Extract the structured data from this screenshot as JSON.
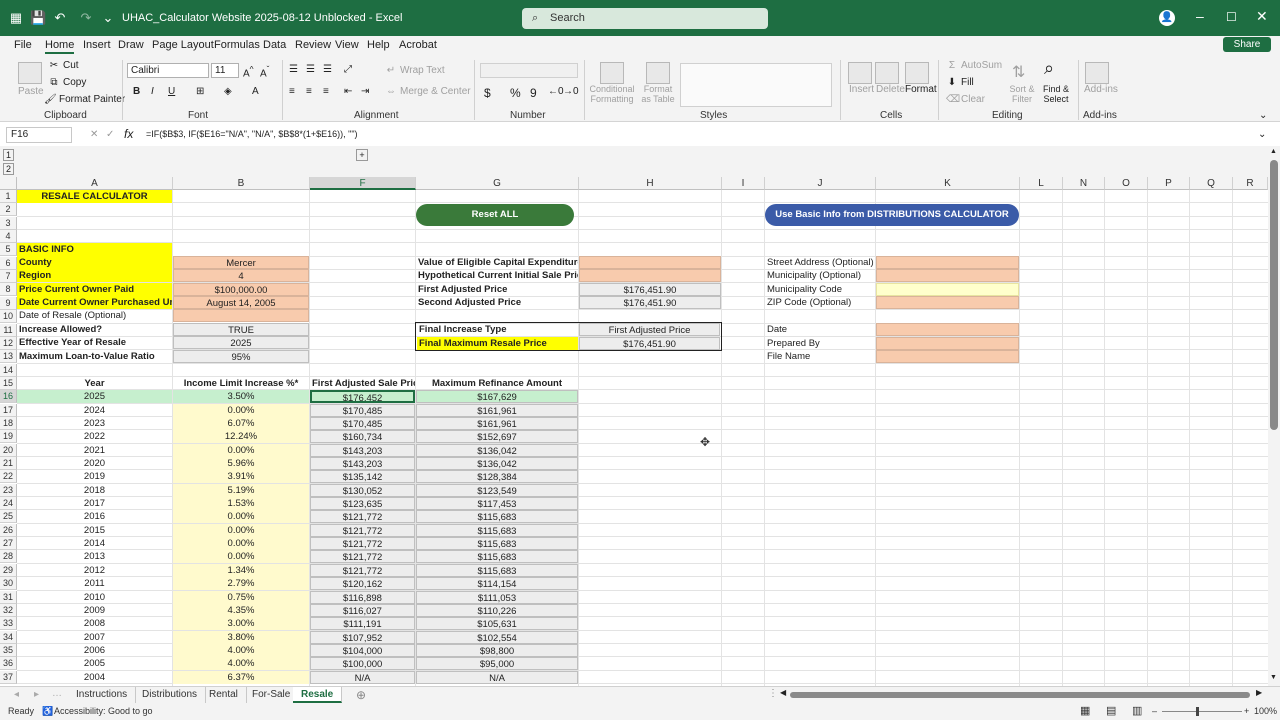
{
  "app": {
    "title": "UHAC_Calculator Website 2025-08-12 Unblocked  -  Excel",
    "search_placeholder": "Search",
    "avatar": "👤",
    "share_label": "Share"
  },
  "menu": [
    "File",
    "Home",
    "Insert",
    "Draw",
    "Page Layout",
    "Formulas",
    "Data",
    "Review",
    "View",
    "Help",
    "Acrobat"
  ],
  "ribbon": {
    "paste": "Paste",
    "cut": "Cut",
    "copy": "Copy",
    "format_painter": "Format Painter",
    "clipboard": "Clipboard",
    "font_name": "Calibri",
    "font_size": "11",
    "font": "Font",
    "wrap_text": "Wrap Text",
    "merge_center": "Merge & Center",
    "alignment": "Alignment",
    "number": "Number",
    "conditional_formatting": "Conditional Formatting",
    "format_as_table": "Format as Table",
    "styles": "Styles",
    "insert": "Insert",
    "delete": "Delete",
    "format": "Format",
    "cells": "Cells",
    "autosum": "AutoSum",
    "fill": "Fill",
    "clear": "Clear",
    "sort_filter": "Sort & Filter",
    "find_select": "Find & Select",
    "editing": "Editing",
    "addins": "Add-ins",
    "addins_group": "Add-ins"
  },
  "formula_bar": {
    "name_box": "F16",
    "fx": "fx",
    "formula": "=IF($B$3, IF($E16=\"N/A\", \"N/A\", $B$8*(1+$E16)), \"\")"
  },
  "columns": [
    "A",
    "B",
    "F",
    "G",
    "H",
    "I",
    "J",
    "K",
    "L",
    "N",
    "O",
    "P",
    "Q",
    "R"
  ],
  "rows": [
    "1",
    "2",
    "3",
    "4",
    "5",
    "6",
    "7",
    "8",
    "9",
    "10",
    "11",
    "12",
    "13",
    "14",
    "15",
    "16",
    "17",
    "18",
    "19",
    "20",
    "21",
    "22",
    "23",
    "24",
    "25",
    "26",
    "27",
    "28",
    "29",
    "30",
    "31",
    "32",
    "33",
    "34",
    "35",
    "36",
    "37"
  ],
  "sheet": {
    "resale_calculator": "RESALE CALCULATOR",
    "reset_all": "Reset ALL",
    "use_basic_info": "Use Basic Info from DISTRIBUTIONS CALCULATOR",
    "basic_info": "BASIC INFO",
    "county_label": "County",
    "county_value": "Mercer",
    "region_label": "Region",
    "region_value": "4",
    "price_paid_label": "Price Current Owner Paid",
    "price_paid_value": "$100,000.00",
    "date_purchased_label": "Date Current Owner Purchased Unit",
    "date_purchased_value": "August 14, 2005",
    "date_resale_label": "Date of Resale (Optional)",
    "increase_allowed_label": "Increase Allowed?",
    "increase_allowed_value": "TRUE",
    "effective_year_label": "Effective Year of Resale",
    "effective_year_value": "2025",
    "ltv_label": "Maximum Loan-to-Value Ratio",
    "ltv_value": "95%",
    "capex_label": "Value of Eligible Capital Expenditures",
    "hypothetical_label": "Hypothetical Current Initial Sale Price",
    "first_adj_label": "First Adjusted Price",
    "first_adj_value": "$176,451.90",
    "second_adj_label": "Second Adjusted Price",
    "second_adj_value": "$176,451.90",
    "final_type_label": "Final Increase Type",
    "final_type_value": "First Adjusted Price",
    "final_max_label": "Final Maximum Resale Price",
    "final_max_value": "$176,451.90",
    "street_label": "Street Address (Optional)",
    "municipality_label": "Municipality (Optional)",
    "municipality_code_label": "Municipality Code",
    "zip_label": "ZIP Code (Optional)",
    "date_label": "Date",
    "prepared_by_label": "Prepared By",
    "file_name_label": "File Name"
  },
  "table": {
    "headers": [
      "Year",
      "Income Limit Increase %*",
      "First Adjusted Sale Price",
      "Maximum Refinance Amount"
    ],
    "rows": [
      [
        "2025",
        "3.50%",
        "$176,452",
        "$167,629"
      ],
      [
        "2024",
        "0.00%",
        "$170,485",
        "$161,961"
      ],
      [
        "2023",
        "6.07%",
        "$170,485",
        "$161,961"
      ],
      [
        "2022",
        "12.24%",
        "$160,734",
        "$152,697"
      ],
      [
        "2021",
        "0.00%",
        "$143,203",
        "$136,042"
      ],
      [
        "2020",
        "5.96%",
        "$143,203",
        "$136,042"
      ],
      [
        "2019",
        "3.91%",
        "$135,142",
        "$128,384"
      ],
      [
        "2018",
        "5.19%",
        "$130,052",
        "$123,549"
      ],
      [
        "2017",
        "1.53%",
        "$123,635",
        "$117,453"
      ],
      [
        "2016",
        "0.00%",
        "$121,772",
        "$115,683"
      ],
      [
        "2015",
        "0.00%",
        "$121,772",
        "$115,683"
      ],
      [
        "2014",
        "0.00%",
        "$121,772",
        "$115,683"
      ],
      [
        "2013",
        "0.00%",
        "$121,772",
        "$115,683"
      ],
      [
        "2012",
        "1.34%",
        "$121,772",
        "$115,683"
      ],
      [
        "2011",
        "2.79%",
        "$120,162",
        "$114,154"
      ],
      [
        "2010",
        "0.75%",
        "$116,898",
        "$111,053"
      ],
      [
        "2009",
        "4.35%",
        "$116,027",
        "$110,226"
      ],
      [
        "2008",
        "3.00%",
        "$111,191",
        "$105,631"
      ],
      [
        "2007",
        "3.80%",
        "$107,952",
        "$102,554"
      ],
      [
        "2006",
        "4.00%",
        "$104,000",
        "$98,800"
      ],
      [
        "2005",
        "4.00%",
        "$100,000",
        "$95,000"
      ],
      [
        "2004",
        "6.37%",
        "N/A",
        "N/A"
      ]
    ]
  },
  "tabs": [
    "Instructions",
    "Distributions",
    "Rental",
    "For-Sale",
    "Resale"
  ],
  "status": {
    "ready": "Ready",
    "accessibility": "Accessibility: Good to go",
    "zoom": "100%"
  },
  "colors": {
    "excel_green": "#1e6e42",
    "yellow": "#ffff00",
    "orange_input": "#f8cbad",
    "reset_button": "#3a7a3a",
    "distributions_button": "#3b5ba8"
  }
}
